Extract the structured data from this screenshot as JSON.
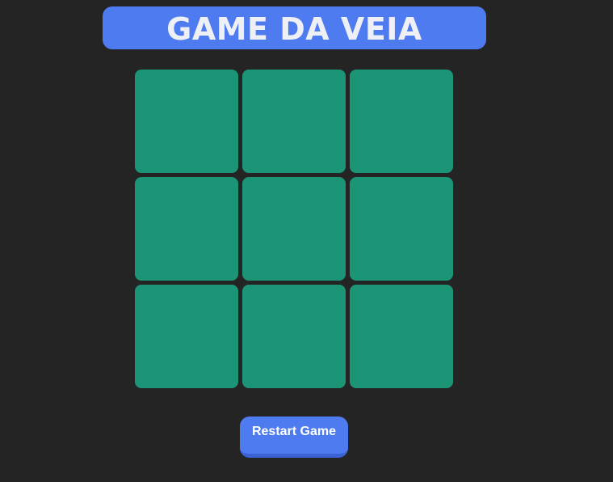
{
  "header": {
    "title": "GAME DA VEIA"
  },
  "board": {
    "cells": [
      "",
      "",
      "",
      "",
      "",
      "",
      "",
      "",
      ""
    ]
  },
  "controls": {
    "restart_label": "Restart Game"
  },
  "colors": {
    "background": "#242424",
    "accent": "#4e7cf0",
    "cell": "#1c9476",
    "title_text": "#eef0f6"
  }
}
